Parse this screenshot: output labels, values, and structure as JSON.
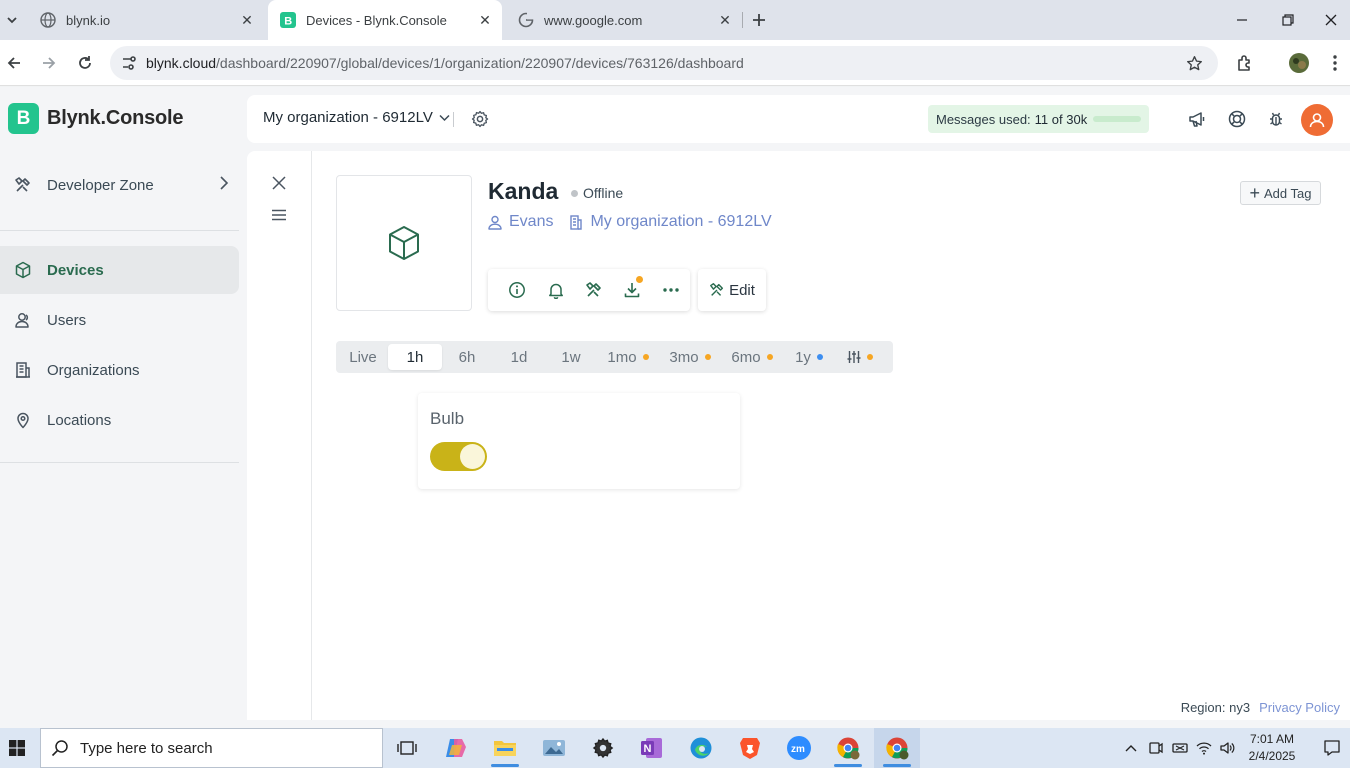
{
  "browser": {
    "tabs": [
      {
        "title": "blynk.io",
        "icon": "globe-icon"
      },
      {
        "title": "Devices - Blynk.Console",
        "icon": "blynk-favicon"
      },
      {
        "title": "www.google.com",
        "icon": "google-icon"
      }
    ],
    "url_host": "blynk.cloud",
    "url_path": "/dashboard/220907/global/devices/1/organization/220907/devices/763126/dashboard"
  },
  "brand": {
    "logo_letter": "B",
    "name": "Blynk.Console",
    "color": "#23c48e"
  },
  "sidebar": {
    "items": [
      {
        "label": "Developer Zone",
        "icon": "tools-icon"
      },
      {
        "label": "Devices",
        "icon": "cube-icon",
        "active": true
      },
      {
        "label": "Users",
        "icon": "users-icon"
      },
      {
        "label": "Organizations",
        "icon": "building-icon"
      },
      {
        "label": "Locations",
        "icon": "location-pin-icon"
      }
    ]
  },
  "header": {
    "org_name": "My organization - 6912LV",
    "messages_label": "Messages used:",
    "messages_value": "11 of 30k"
  },
  "device": {
    "name": "Kanda",
    "status": "Offline",
    "owner": "Evans",
    "organization": "My organization - 6912LV",
    "add_tag_label": "Add Tag",
    "edit_label": "Edit"
  },
  "time_ranges": [
    {
      "label": "Live"
    },
    {
      "label": "1h",
      "active": true
    },
    {
      "label": "6h"
    },
    {
      "label": "1d"
    },
    {
      "label": "1w"
    },
    {
      "label": "1mo",
      "dot": "#f6a623"
    },
    {
      "label": "3mo",
      "dot": "#f6a623"
    },
    {
      "label": "6mo",
      "dot": "#f6a623"
    },
    {
      "label": "1y",
      "dot": "#3d8ef0"
    }
  ],
  "widget": {
    "title": "Bulb",
    "switch_on": true,
    "switch_color": "#c9b318"
  },
  "footer": {
    "region": "Region: ny3",
    "privacy": "Privacy Policy"
  },
  "taskbar": {
    "search_placeholder": "Type here to search",
    "time": "7:01 AM",
    "date": "2/4/2025"
  }
}
